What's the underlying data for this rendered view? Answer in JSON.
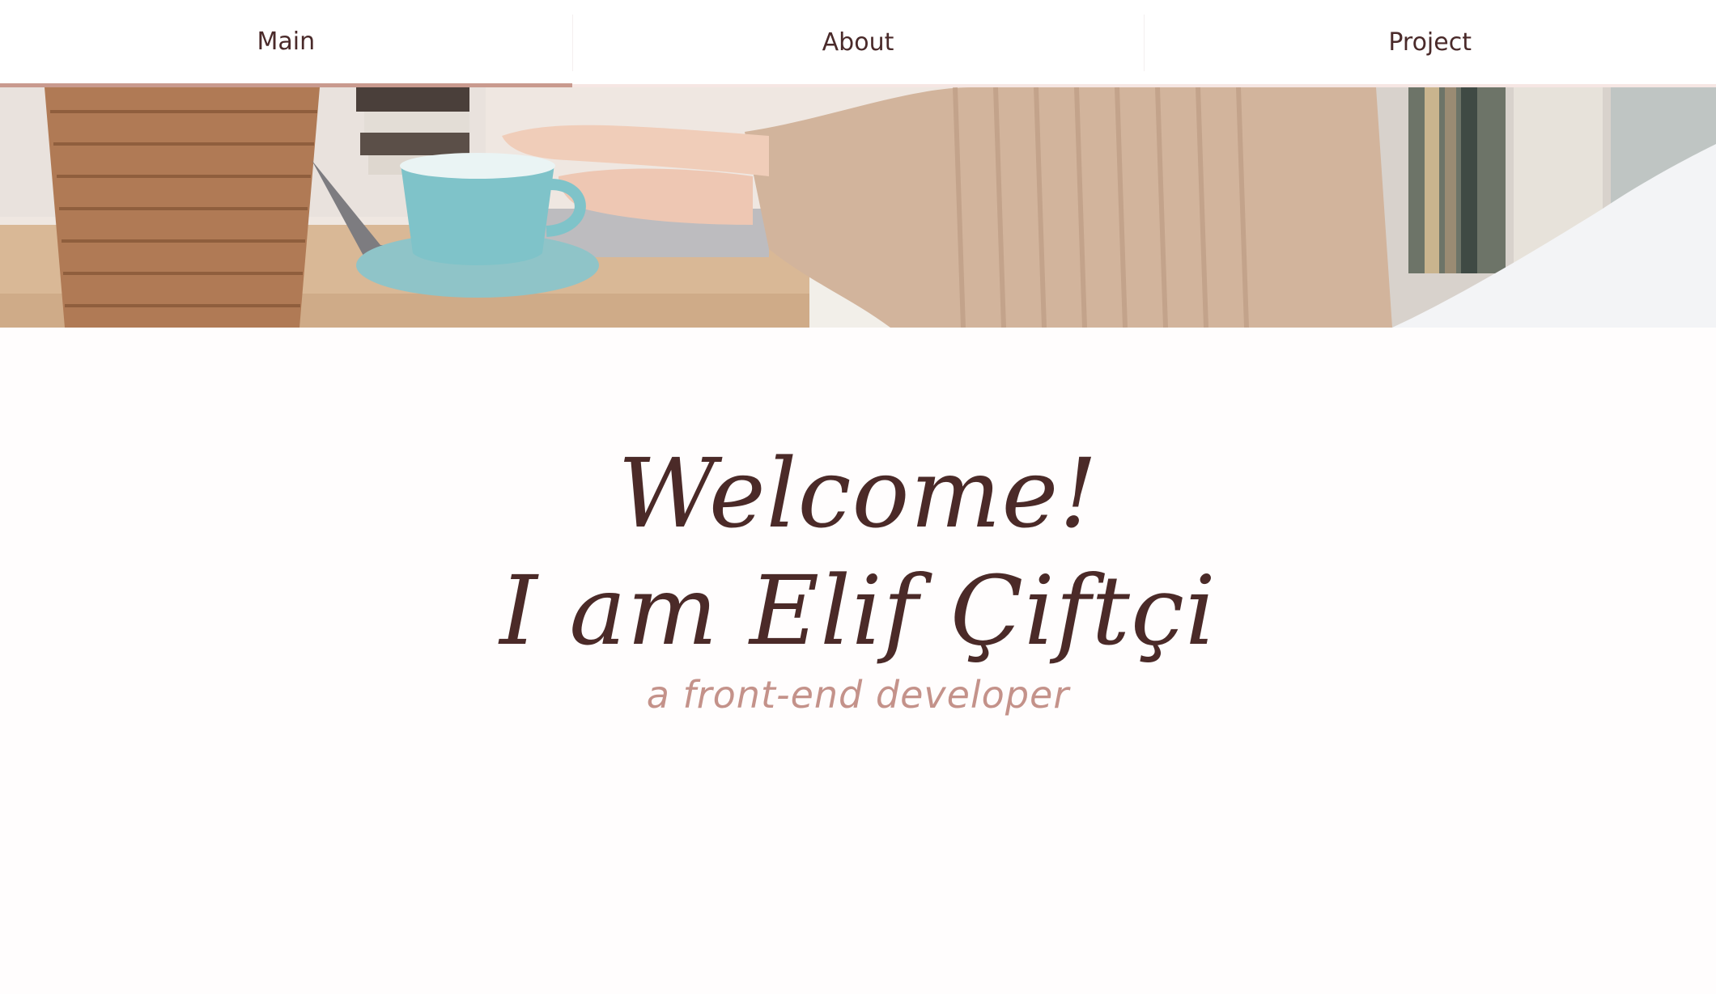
{
  "nav": {
    "tabs": [
      {
        "label": "Main",
        "active": true
      },
      {
        "label": "About",
        "active": false
      },
      {
        "label": "Project",
        "active": false
      }
    ]
  },
  "hero": {
    "image": "photo of hands typing on a laptop next to a teal coffee cup and wicker basket"
  },
  "intro": {
    "welcome": "Welcome!",
    "name": "I am Elif Çiftçi",
    "role": "a front-end developer"
  },
  "colors": {
    "accent": "#c99a8e",
    "heading": "#4b2a28",
    "role_text": "#c4928a",
    "nav_text": "#4a2a2a"
  }
}
